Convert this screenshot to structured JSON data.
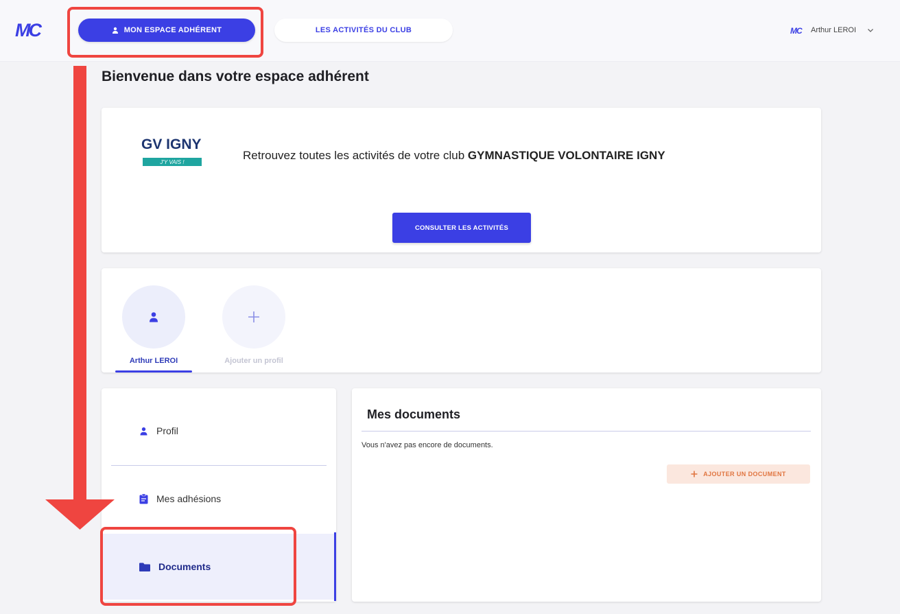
{
  "header": {
    "logo_text": "MC",
    "nav_primary_label": "MON ESPACE ADHÉRENT",
    "nav_secondary_label": "LES ACTIVITÉS DU CLUB",
    "user_logo_text": "MC",
    "user_name": "Arthur LEROI"
  },
  "main": {
    "headline": "Bienvenue dans votre espace adhérent",
    "club_card": {
      "logo_title": "GV IGNY",
      "logo_tagline": "J'Y VAIS !",
      "text_prefix": "Retrouvez toutes les activités de votre club",
      "club_name": "GYMNASTIQUE VOLONTAIRE IGNY",
      "button_label": "CONSULTER LES ACTIVITÉS"
    },
    "profiles": [
      {
        "name": "Arthur LEROI",
        "icon": "person-icon",
        "active": true
      },
      {
        "name": "Ajouter un profil",
        "icon": "plus-icon",
        "active": false
      }
    ],
    "sidebar": {
      "items": [
        {
          "label": "Profil",
          "icon": "person-icon"
        },
        {
          "label": "Mes adhésions",
          "icon": "clipboard-icon"
        },
        {
          "label": "Documents",
          "icon": "folder-icon",
          "active": true
        }
      ]
    },
    "documents": {
      "title": "Mes documents",
      "empty_text": "Vous n'avez pas encore de documents.",
      "add_button_label": "AJOUTER UN DOCUMENT"
    }
  },
  "colors": {
    "primary": "#3b3fe4",
    "annotation": "#ef4540",
    "club_teal": "#1fa5a0",
    "club_navy": "#1d3570",
    "accent_orange": "#e0743f"
  }
}
